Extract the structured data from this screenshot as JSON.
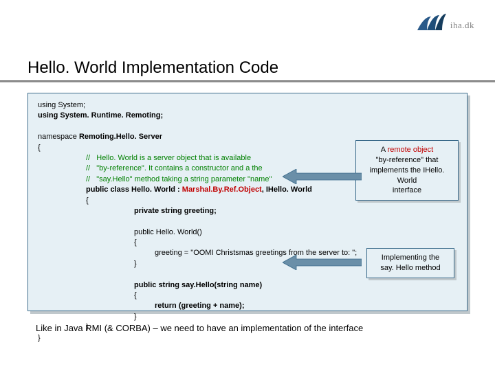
{
  "header": {
    "brand_text": "iha.dk",
    "logo_name": "iha-logo"
  },
  "title": "Hello. World Implementation Code",
  "code": {
    "l1": "using System;",
    "l2a": "using System. Runtime. Remoting;",
    "l3a": "namespace ",
    "l3b": "Remoting.Hello. Server",
    "l4": "{",
    "c1": "//   Hello. World is a server object that is available",
    "c2": "//   \"by-reference\". It contains a constructor and a the",
    "c3": "//   \"say.Hello\" method taking a string parameter \"name\"",
    "pc1": "public class Hello. World : ",
    "pc2": "Marshal.By.Ref.Object",
    "pc3": ", ",
    "pc4": "IHello. World",
    "ob": "{",
    "pg": "private string greeting;",
    "ctor": "public Hello. World()",
    "ob2": "{",
    "asg": "greeting = \"OOMI Christsmas greetings from the server to: \";",
    "cb2": "}",
    "say": "public string say.Hello(string name)",
    "ob3": "{",
    "ret": "return (greeting + name);",
    "cb3": "}",
    "cb_class": "}",
    "cb_ns": "}"
  },
  "callouts": {
    "c1_l1": "A ",
    "c1_red": "remote object",
    "c1_l2": "\"by-reference\" that",
    "c1_l3": "implements the IHello. World",
    "c1_l4": "interface",
    "c2_l1": "Implementing the",
    "c2_l2": "say. Hello method"
  },
  "footnote": "Like in Java RMI (& CORBA) – we need to have an implementation of the interface",
  "arrow_color": "#6a8fa8"
}
